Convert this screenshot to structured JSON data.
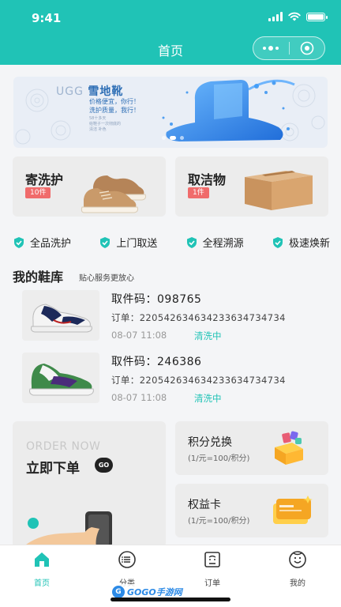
{
  "status_bar": {
    "time": "9:41"
  },
  "header": {
    "title": "首页"
  },
  "banner": {
    "brand_en": "UGG",
    "brand_cn": "雪地靴",
    "slogan_line1": "价格便宜，你行！",
    "slogan_line2": "洗护质量，我行！",
    "sub_line1": "58十多天",
    "sub_line2": "给鞋子一次彻底的",
    "sub_line3": "清洁 补色"
  },
  "services": [
    {
      "title": "寄洗护",
      "badge": "10件"
    },
    {
      "title": "取洁物",
      "badge": "1件"
    }
  ],
  "features": [
    {
      "label": "全品洗护",
      "icon": "shield-check-icon"
    },
    {
      "label": "上门取送",
      "icon": "shield-check-icon"
    },
    {
      "label": "全程溯源",
      "icon": "shield-check-icon"
    },
    {
      "label": "极速焕新",
      "icon": "shield-check-icon"
    }
  ],
  "shoe_library": {
    "title": "我的鞋库",
    "subtitle": "贴心服务更放心",
    "items": [
      {
        "pickup": "取件码：098765",
        "order": "订单：220542634634233634734734",
        "date": "08-07 11:08",
        "status": "清洗中"
      },
      {
        "pickup": "取件码：246386",
        "order": "订单：220542634634233634734734",
        "date": "08-07 11:08",
        "status": "清洗中"
      }
    ]
  },
  "promo": {
    "order_en": "ORDER NOW",
    "order_cn": "立即下单",
    "go": "GO",
    "points_title": "积分兑换",
    "points_sub": "(1/元=100/积分)",
    "rights_title": "权益卡",
    "rights_sub": "(1/元=100/积分)"
  },
  "tabbar": [
    {
      "label": "首页",
      "icon": "home-icon",
      "active": true
    },
    {
      "label": "分类",
      "icon": "category-list-icon",
      "active": false
    },
    {
      "label": "订单",
      "icon": "order-icon",
      "active": false
    },
    {
      "label": "我的",
      "icon": "profile-icon",
      "active": false
    }
  ],
  "watermark": {
    "text": "GOGO手游网"
  },
  "colors": {
    "primary": "#20c3b6",
    "badge": "#f06b6b",
    "card": "#ececec"
  }
}
